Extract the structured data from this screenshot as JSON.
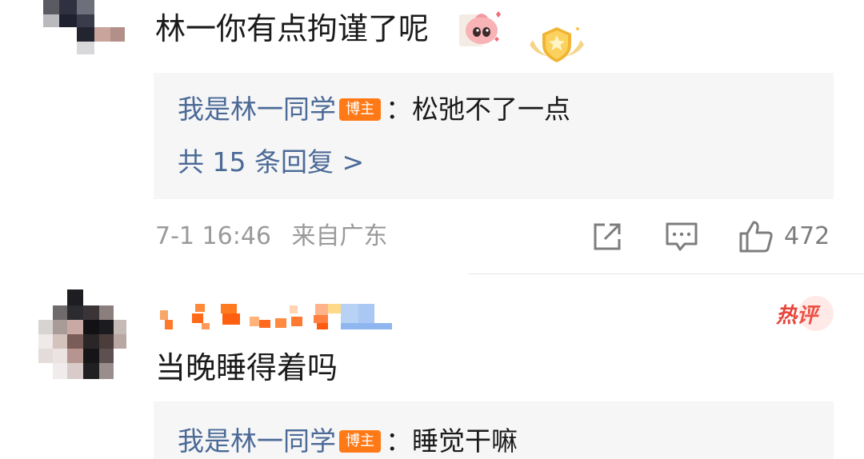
{
  "comments": [
    {
      "text": "林一你有点拘谨了呢",
      "sticker_icon": "cute-pig-sticker-icon",
      "fan_badge_icon": "gold-fan-badge-icon",
      "reply": {
        "author": "我是林一同学",
        "tag": "博主",
        "separator": "：",
        "text": "松弛不了一点",
        "count_label": "共 15 条回复 >"
      },
      "timestamp": "7-1 16:46",
      "location": "来自广东",
      "like_count": "472"
    },
    {
      "text": "当晚睡得着吗",
      "hot_label": "热评",
      "reply": {
        "author": "我是林一同学",
        "tag": "博主",
        "separator": "：",
        "text": "睡觉干嘛"
      }
    }
  ],
  "colors": {
    "link": "#4b6a96",
    "blogger_tag": "#ff7a16",
    "hot": "#e8453a",
    "meta": "#9a9a9a",
    "reply_bg": "#f6f6f7"
  }
}
